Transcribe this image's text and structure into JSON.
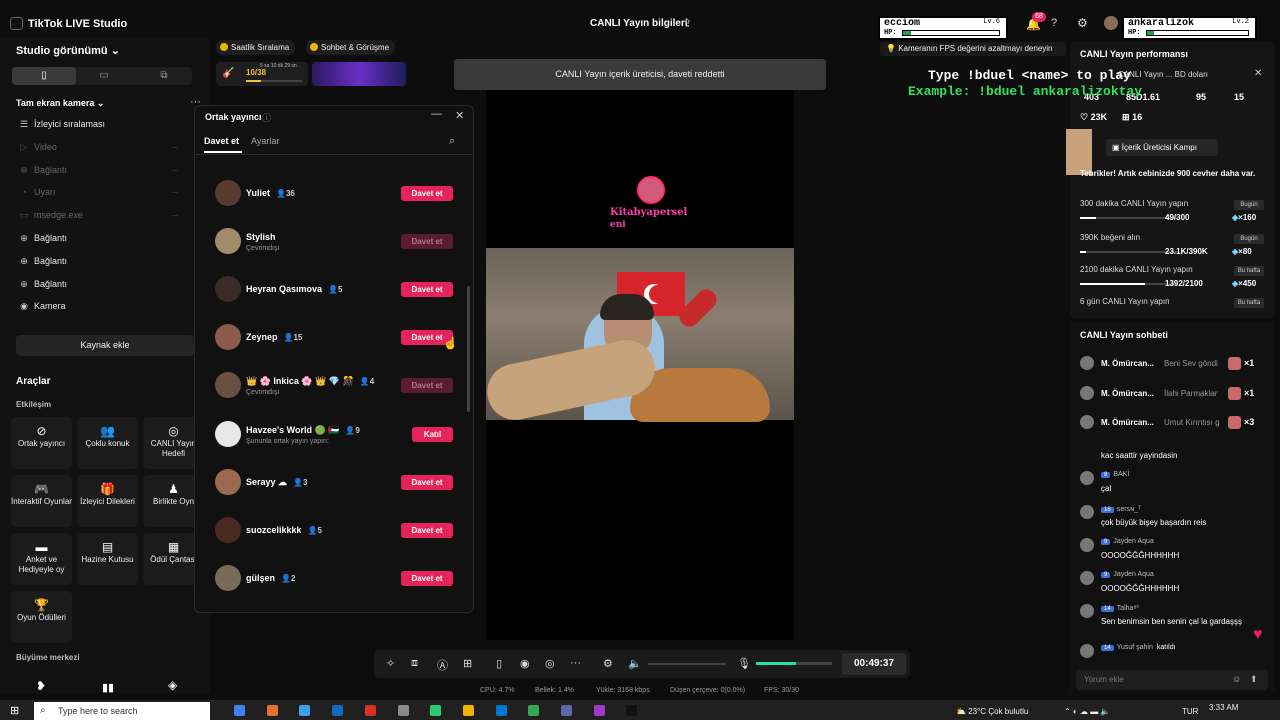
{
  "app": {
    "title": "TikTok LIVE Studio",
    "center_title": "CANLI Yayın bilgileri"
  },
  "left": {
    "studio_view": "Studio görünümü",
    "scene": "Tam ekran kamera",
    "sources": [
      {
        "label": "İzleyici sıralaması",
        "dim": false
      },
      {
        "label": "Video",
        "dim": true
      },
      {
        "label": "Bağlantı",
        "dim": true
      },
      {
        "label": "Uyarı",
        "dim": true
      },
      {
        "label": "msedge.exe",
        "dim": true
      },
      {
        "label": "Bağlantı",
        "dim": false
      },
      {
        "label": "Bağlantı",
        "dim": false
      },
      {
        "label": "Bağlantı",
        "dim": false
      },
      {
        "label": "Kamera",
        "dim": false
      }
    ],
    "add_source": "Kaynak ekle",
    "tools_title": "Araçlar",
    "interaction": "Etkileşim",
    "tools": [
      {
        "label": "Ortak yayıncı",
        "icon": "link-icon"
      },
      {
        "label": "Çoklu konuk",
        "icon": "users-icon"
      },
      {
        "label": "CANLI Yayın Hedefi",
        "icon": "target-icon"
      },
      {
        "label": "İnteraktif Oyunlar",
        "icon": "gamepad-icon"
      },
      {
        "label": "İzleyici Dilekleri",
        "icon": "gift-icon"
      },
      {
        "label": "Birlikte Oyn",
        "icon": "person-icon"
      },
      {
        "label": "Anket ve Hediyeyle oy",
        "icon": "poll-icon"
      },
      {
        "label": "Hazine Kutusu",
        "icon": "chest-icon"
      },
      {
        "label": "Ödül Çantası",
        "icon": "bag-icon"
      },
      {
        "label": "Oyun Ödülleri",
        "icon": "trophy-icon"
      }
    ],
    "growth": "Büyüme merkezi"
  },
  "top_buttons": {
    "ranking": "Saatlik Sıralama",
    "meet": "Sohbet & Görüşme"
  },
  "goal": {
    "progress": "10/38",
    "time": "5 sa 10 dk 29 sn",
    "fraction": 0.26
  },
  "toast": "CANLI Yayın içerik üreticisi, daveti reddetti",
  "stream_overlay": {
    "name1": "Kitabyapersel",
    "name2": "eni"
  },
  "controls": {
    "timer": "00:49:37",
    "volume": 0.0,
    "mic_level": 0.53
  },
  "stats": {
    "cpu": "CPU:  4.7%",
    "mem": "Bellek:  1.4%",
    "upload": "Yükle: 3168 kbps",
    "dropped": "Düşen çerçeve:  0(0.0%)",
    "fps": "FPS:  30/30"
  },
  "panel": {
    "title": "Ortak yayıncı",
    "tab_invite": "Davet et",
    "tab_settings": "Ayarlar",
    "rows": [
      {
        "name": "Yuliet",
        "count": "36",
        "sub": "",
        "btn": "Davet et",
        "dis": false,
        "color": "#5a3a30"
      },
      {
        "name": "Stylish",
        "count": "",
        "sub": "Çevrimdışı",
        "btn": "Davet et",
        "dis": true,
        "color": "#a08c6a"
      },
      {
        "name": "Heyran Qasımova",
        "count": "5",
        "sub": "",
        "btn": "Davet et",
        "dis": false,
        "color": "#3a2a28"
      },
      {
        "name": "Zeynep",
        "count": "15",
        "sub": "",
        "btn": "Davet et",
        "dis": false,
        "color": "#8a5a4a"
      },
      {
        "name": "👑 🌸 Inkica 🌸 👑 💎 🎊",
        "count": "4",
        "sub": "Çevrimdışı",
        "btn": "Davet et",
        "dis": true,
        "color": "#6a5040"
      },
      {
        "name": "Havzee's World 🟢 🇵🇸",
        "count": "9",
        "sub": "Şununla ortak yayın yapın:",
        "btn": "Katıl",
        "dis": false,
        "color": "#e8e8e8"
      },
      {
        "name": "Serayy ☁",
        "count": "3",
        "sub": "",
        "btn": "Davet et",
        "dis": false,
        "color": "#9a6a50"
      },
      {
        "name": "suozcelikkkk",
        "count": "5",
        "sub": "",
        "btn": "Davet et",
        "dis": false,
        "color": "#4a2a20"
      },
      {
        "name": "gülşen",
        "count": "2",
        "sub": "",
        "btn": "Davet et",
        "dis": false,
        "color": "#7a6a58"
      }
    ]
  },
  "hud": {
    "p1": {
      "name": "ecciom",
      "level": "Lv.6",
      "hp": 0.08
    },
    "p2": {
      "name": "ankaralizok",
      "level": "Lv.2",
      "hp": 0.07
    },
    "hp_label": "HP:"
  },
  "notif_count": "68",
  "fps_tip": "Kameranın FPS değerini azaltmayı deneyin",
  "game_text": {
    "type_cmd": "Type !bduel <name> to play",
    "example": "Example: !bduel ankaralizoktay"
  },
  "perf": {
    "title": "CANLI Yayın performansı",
    "line": "CANLI Yayın ... BD doları",
    "stats": [
      "403",
      "85D1.61",
      "95",
      "15"
    ],
    "likes": "23K",
    "gifts": "16",
    "camp": "İçerik Üreticisi Kampı",
    "congrats": "Tebrikler! Artık cebinizde 900 cevher daha var.",
    "tasks": [
      {
        "label": "300 dakika CANLI Yayın yapın",
        "badge": "Bugün",
        "prog": "49/300",
        "fraction": 0.16,
        "reward": "×160"
      },
      {
        "label": "390K beğeni alın",
        "badge": "Bugün",
        "prog": "23.1K/390K",
        "fraction": 0.06,
        "reward": "×80"
      },
      {
        "label": "2100 dakika CANLI Yayın yapın",
        "badge": "Bu hafta",
        "prog": "1392/2100",
        "fraction": 0.66,
        "reward": "×450"
      },
      {
        "label": "6 gün CANLI Yayın yapın",
        "badge": "Bu hafta",
        "prog": "",
        "fraction": 0.0,
        "reward": ""
      }
    ]
  },
  "chat": {
    "title": "CANLI Yayın sohbeti",
    "gifts": [
      {
        "name": "M. Ömürcan...",
        "gift": "Beni Sev göndi",
        "x": "×1"
      },
      {
        "name": "M. Ömürcan...",
        "gift": "İlahi Parmaklar",
        "x": "×1"
      },
      {
        "name": "M. Ömürcan...",
        "gift": "Umut Kırıntısı g",
        "x": "×3"
      }
    ],
    "messages": [
      {
        "user": "",
        "level": "",
        "msg": "kac saattir yayindasin"
      },
      {
        "user": "BAKİ",
        "level": "8",
        "msg": "çal"
      },
      {
        "user": "ꜱerꜱɴ_ᵀ",
        "level": "16",
        "msg": "çok büyük bişey başardın reis"
      },
      {
        "user": "Jayden Aqua",
        "level": "9",
        "msg": "OOOOĞĞĞHHHHHH"
      },
      {
        "user": "Jayden Aqua",
        "level": "9",
        "msg": "OOOOĞĞĞHHHHHH"
      },
      {
        "user": "Talha⁸⁰",
        "level": "14",
        "msg": "Sen benimsin ben senin çal la gardaşşş"
      },
      {
        "user": "Yusuf şahin",
        "level": "14",
        "msg": "katıldı"
      }
    ],
    "placeholder": "Yorum ekle"
  },
  "taskbar": {
    "search": "Type here to search",
    "weather": "23°C  Çok bulutlu",
    "lang": "TUR",
    "time": "3:33 AM"
  }
}
